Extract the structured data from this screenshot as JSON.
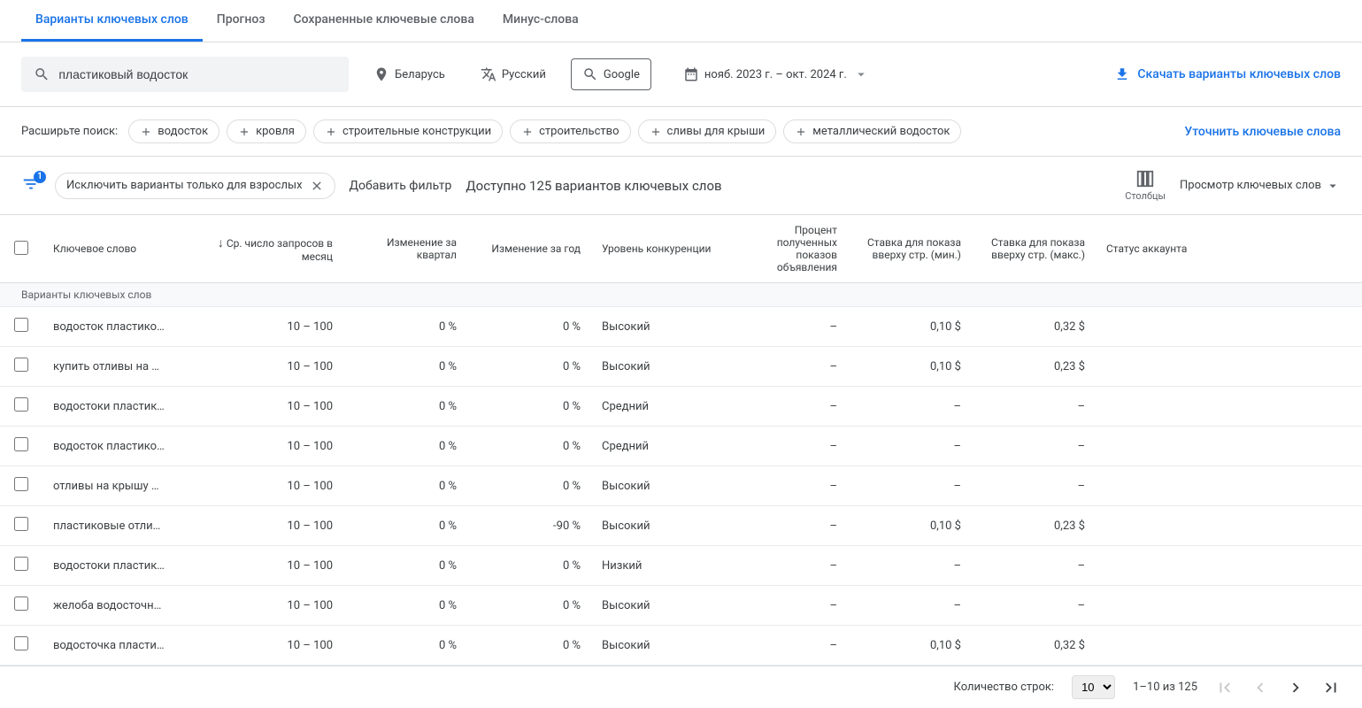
{
  "tabs": [
    {
      "label": "Варианты ключевых слов",
      "active": true
    },
    {
      "label": "Прогноз",
      "active": false
    },
    {
      "label": "Сохраненные ключевые слова",
      "active": false
    },
    {
      "label": "Минус-слова",
      "active": false
    }
  ],
  "search": {
    "query": "пластиковый водосток"
  },
  "settings": {
    "location": "Беларусь",
    "language": "Русский",
    "network": "Google",
    "date_range": "нояб. 2023 г. – окт. 2024 г."
  },
  "download_label": "Скачать варианты ключевых слов",
  "broaden": {
    "label": "Расширьте поиск:",
    "chips": [
      "водосток",
      "кровля",
      "строительные конструкции",
      "строительство",
      "сливы для крыши",
      "металлический водосток"
    ]
  },
  "refine_label": "Уточнить ключевые слова",
  "filter_row": {
    "badge": "1",
    "applied_filter": "Исключить варианты только для взрослых",
    "add_filter": "Добавить фильтр",
    "available": "Доступно 125 вариантов ключевых слов",
    "columns": "Столбцы",
    "view": "Просмотр ключевых слов"
  },
  "headers": {
    "keyword": "Ключевое слово",
    "volume": "Ср. число запросов в месяц",
    "quarter": "Изменение за квартал",
    "year": "Изменение за год",
    "competition": "Уровень конкуренции",
    "impression_share": "Процент полученных показов объявления",
    "bid_min": "Ставка для показа вверху стр. (мин.)",
    "bid_max": "Ставка для показа вверху стр. (макс.)",
    "account_status": "Статус аккаунта"
  },
  "section_label": "Варианты ключевых слов",
  "rows": [
    {
      "keyword": "водосток пластиков…",
      "volume": "10 – 100",
      "quarter": "0 %",
      "year": "0 %",
      "competition": "Высокий",
      "impr": "–",
      "min": "0,10 $",
      "max": "0,32 $"
    },
    {
      "keyword": "купить отливы на кр…",
      "volume": "10 – 100",
      "quarter": "0 %",
      "year": "0 %",
      "competition": "Высокий",
      "impr": "–",
      "min": "0,10 $",
      "max": "0,23 $"
    },
    {
      "keyword": "водостоки пластико…",
      "volume": "10 – 100",
      "quarter": "0 %",
      "year": "0 %",
      "competition": "Средний",
      "impr": "–",
      "min": "–",
      "max": "–"
    },
    {
      "keyword": "водосток пластиков…",
      "volume": "10 – 100",
      "quarter": "0 %",
      "year": "0 %",
      "competition": "Средний",
      "impr": "–",
      "min": "–",
      "max": "–"
    },
    {
      "keyword": "отливы на крышу пл…",
      "volume": "10 – 100",
      "quarter": "0 %",
      "year": "0 %",
      "competition": "Высокий",
      "impr": "–",
      "min": "–",
      "max": "–"
    },
    {
      "keyword": "пластиковые отлив…",
      "volume": "10 – 100",
      "quarter": "0 %",
      "year": "-90 %",
      "competition": "Высокий",
      "impr": "–",
      "min": "0,10 $",
      "max": "0,23 $"
    },
    {
      "keyword": "водостоки пластико…",
      "volume": "10 – 100",
      "quarter": "0 %",
      "year": "0 %",
      "competition": "Низкий",
      "impr": "–",
      "min": "–",
      "max": "–"
    },
    {
      "keyword": "желоба водосточны…",
      "volume": "10 – 100",
      "quarter": "0 %",
      "year": "0 %",
      "competition": "Высокий",
      "impr": "–",
      "min": "–",
      "max": "–"
    },
    {
      "keyword": "водосточка пластик…",
      "volume": "10 – 100",
      "quarter": "0 %",
      "year": "0 %",
      "competition": "Высокий",
      "impr": "–",
      "min": "0,10 $",
      "max": "0,32 $"
    }
  ],
  "footer": {
    "rows_per_page_label": "Количество строк:",
    "rows_per_page": "10",
    "range": "1–10 из 125"
  }
}
